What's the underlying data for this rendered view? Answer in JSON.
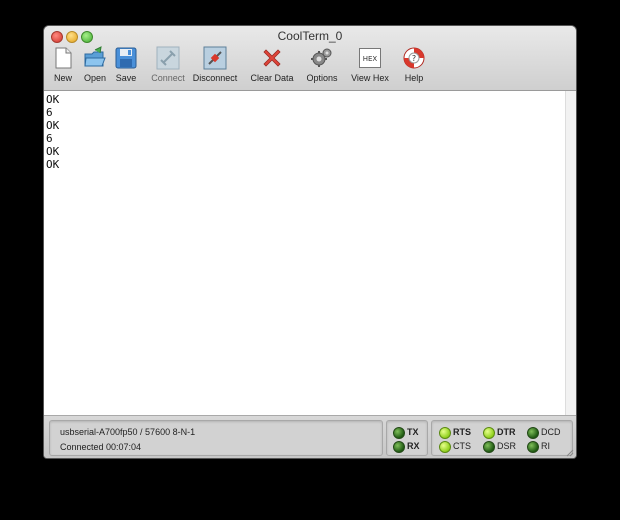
{
  "window": {
    "title": "CoolTerm_0"
  },
  "toolbar": {
    "new_label": "New",
    "open_label": "Open",
    "save_label": "Save",
    "connect_label": "Connect",
    "disconnect_label": "Disconnect",
    "clear_label": "Clear Data",
    "options_label": "Options",
    "viewhex_label": "View Hex",
    "viewhex_icon_text": "HEX",
    "help_label": "Help"
  },
  "terminal": {
    "lines": [
      "OK",
      "6",
      "OK",
      "6",
      "OK",
      "OK"
    ]
  },
  "status": {
    "port_info": "usbserial-A700fp50 / 57600 8-N-1",
    "connection": "Connected 00:07:04"
  },
  "leds": {
    "tx": "TX",
    "rx": "RX",
    "rts": "RTS",
    "cts": "CTS",
    "dtr": "DTR",
    "dsr": "DSR",
    "dcd": "DCD",
    "ri": "RI"
  },
  "colors": {
    "led_dark": "#2f7a1f",
    "led_bright": "#a6e02a"
  }
}
